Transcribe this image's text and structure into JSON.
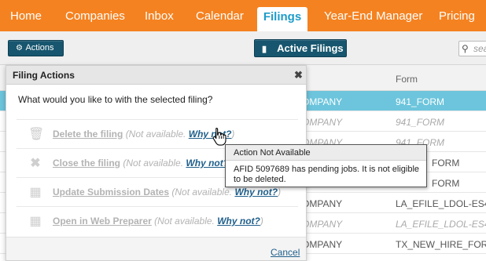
{
  "nav": {
    "tabs": [
      {
        "label": "Home"
      },
      {
        "label": "Companies"
      },
      {
        "label": "Inbox"
      },
      {
        "label": "Calendar"
      },
      {
        "label": "Filings",
        "active": true
      },
      {
        "label": "Year-End Manager"
      },
      {
        "label": "Pricing"
      }
    ]
  },
  "toolbar": {
    "actions_label": "Actions",
    "actions_icon": "gear-icon",
    "active_filings_label": "Active Filings",
    "active_filings_icon": "file-icon",
    "search_placeholder": "sea"
  },
  "table": {
    "header_form": "Form",
    "rows": [
      {
        "company": "OMPANY",
        "form": "941_FORM",
        "state": "selected"
      },
      {
        "company": "OMPANY",
        "form": "941_FORM",
        "state": "muted"
      },
      {
        "company": "OMPANY",
        "form": "941_FORM",
        "state": "muted"
      },
      {
        "company": "",
        "form": "FORM",
        "state": "plain"
      },
      {
        "company": "",
        "form": "FORM",
        "state": "plain"
      },
      {
        "company": "OMPANY",
        "form": "LA_EFILE_LDOL-ES4.",
        "state": "plain"
      },
      {
        "company": "OMPANY",
        "form": "LA_EFILE_LDOL-ES4.",
        "state": "muted"
      },
      {
        "company": "OMPANY",
        "form": "TX_NEW_HIRE_FORM",
        "state": "plain"
      }
    ]
  },
  "modal": {
    "title": "Filing Actions",
    "close_icon": "close-icon",
    "question": "What would you like to with the selected filing?",
    "actions": [
      {
        "label": "Delete the filing",
        "icon": "trash-icon",
        "note": "(Not available.",
        "why": "Why not?",
        "close": ")"
      },
      {
        "label": "Close the filing",
        "icon": "x-icon",
        "note": "(Not available.",
        "why": "Why not?",
        "close": ")"
      },
      {
        "label": "Update Submission Dates",
        "icon": "calendar-icon",
        "note": "(Not available.",
        "why": "Why not?",
        "close": ")"
      },
      {
        "label": "Open in Web Preparer",
        "icon": "table-icon",
        "note": "(Not available.",
        "why": "Why not?",
        "close": ")"
      }
    ],
    "cancel_label": "Cancel"
  },
  "tooltip": {
    "title": "Action Not Available",
    "body": "AFID 5097689 has pending jobs. It is not eligible to be deleted."
  },
  "colors": {
    "nav_bg": "#f58220",
    "active_tab_text": "#1d9cc9",
    "button_bg": "#17566e",
    "selected_row": "#6cc5dc",
    "link": "#1f5f8b"
  }
}
